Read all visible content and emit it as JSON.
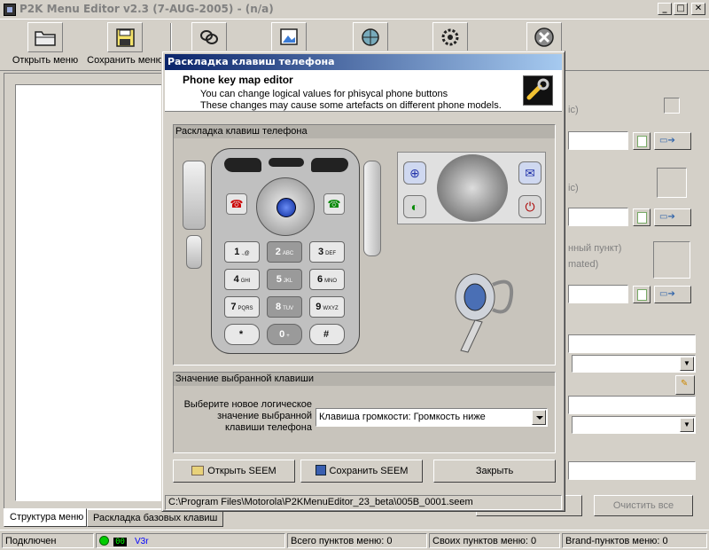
{
  "window": {
    "title": "P2K Menu Editor v2.3 (7-AUG-2005) - (n/a)",
    "min": "_",
    "max": "□",
    "close": "✕"
  },
  "toolbar": {
    "open_menu": "Открыть меню",
    "save_menu": "Сохранить меню"
  },
  "tabs": {
    "menu_structure": "Структура меню",
    "base_keys": "Раскладка базовых клавиш"
  },
  "right_panel": {
    "text_ic_1": "ic)",
    "text_ic_2": "ic)",
    "text_menu_item": "нный пункт)",
    "text_mated": "mated)",
    "clear_all": "Очистить все"
  },
  "statusbar": {
    "connection": "Подключен",
    "indicator": "00",
    "version": "V3r",
    "total_items": "Всего пунктов меню: 0",
    "own_items": "Своих пунктов меню: 0",
    "brand_items": "Brand-пунктов меню: 0"
  },
  "dialog": {
    "title": "Раскладка клавиш телефона",
    "header_title": "Phone key map editor",
    "header_line1": "You can change logical values for phisycal phone buttons",
    "header_line2": "These changes may cause some artefacts on different phone models.",
    "group_keymap": "Раскладка клавиш телефона",
    "group_value": "Значение выбранной клавиши",
    "prompt_line1": "Выберите новое логическое",
    "prompt_line2": "значение выбранной",
    "prompt_line3": "клавиши телефона",
    "selected_value": "Клавиша громкости: Громкость ниже",
    "open_seem": "Открыть SEEM",
    "save_seem": "Сохранить SEEM",
    "close": "Закрыть",
    "path": "C:\\Program Files\\Motorola\\P2KMenuEditor_23_beta\\005B_0001.seem"
  },
  "keypad": {
    "keys": [
      {
        "main": "1",
        "sub": ".,@"
      },
      {
        "main": "2",
        "sub": "ABC"
      },
      {
        "main": "3",
        "sub": "DEF"
      },
      {
        "main": "4",
        "sub": "GHI"
      },
      {
        "main": "5",
        "sub": "JKL"
      },
      {
        "main": "6",
        "sub": "MNO"
      },
      {
        "main": "7",
        "sub": "PQRS"
      },
      {
        "main": "8",
        "sub": "TUV"
      },
      {
        "main": "9",
        "sub": "WXYZ"
      },
      {
        "main": "*",
        "sub": ""
      },
      {
        "main": "0",
        "sub": "+"
      },
      {
        "main": "#",
        "sub": ""
      }
    ]
  },
  "colors": {
    "accent_title": "#0a246a",
    "indicator_green": "#00cc00"
  }
}
